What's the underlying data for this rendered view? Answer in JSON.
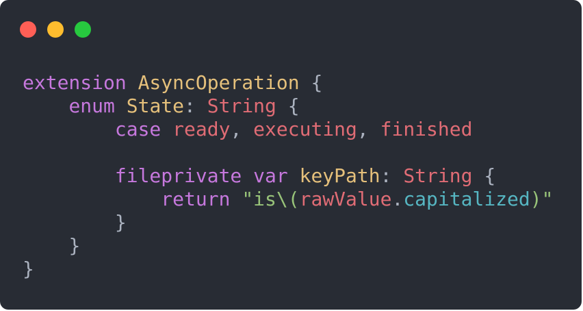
{
  "window": {
    "controls": [
      "close-button",
      "minimize-button",
      "zoom-button"
    ]
  },
  "colors": {
    "background": "#282c34",
    "close": "#ff5f56",
    "minimize": "#ffbd2e",
    "zoom": "#27c93f",
    "keyword": "#c678dd",
    "type": "#e5c07b",
    "identifier": "#e06c75",
    "string": "#98c379",
    "method": "#56b6c2",
    "punctuation": "#abb2bf"
  },
  "code": {
    "lines": [
      [
        {
          "t": "extension",
          "c": "keyword"
        },
        {
          "t": " ",
          "c": "punct"
        },
        {
          "t": "AsyncOperation",
          "c": "type"
        },
        {
          "t": " {",
          "c": "punct"
        }
      ],
      [
        {
          "t": "    ",
          "c": "punct"
        },
        {
          "t": "enum",
          "c": "keyword"
        },
        {
          "t": " ",
          "c": "punct"
        },
        {
          "t": "State",
          "c": "type"
        },
        {
          "t": ": ",
          "c": "punct"
        },
        {
          "t": "String",
          "c": "red"
        },
        {
          "t": " {",
          "c": "punct"
        }
      ],
      [
        {
          "t": "        ",
          "c": "punct"
        },
        {
          "t": "case",
          "c": "keyword"
        },
        {
          "t": " ",
          "c": "punct"
        },
        {
          "t": "ready",
          "c": "red"
        },
        {
          "t": ", ",
          "c": "punct"
        },
        {
          "t": "executing",
          "c": "red"
        },
        {
          "t": ", ",
          "c": "punct"
        },
        {
          "t": "finished",
          "c": "red"
        }
      ],
      [],
      [
        {
          "t": "        ",
          "c": "punct"
        },
        {
          "t": "fileprivate",
          "c": "keyword"
        },
        {
          "t": " ",
          "c": "punct"
        },
        {
          "t": "var",
          "c": "keyword"
        },
        {
          "t": " ",
          "c": "punct"
        },
        {
          "t": "keyPath",
          "c": "type"
        },
        {
          "t": ": ",
          "c": "punct"
        },
        {
          "t": "String",
          "c": "red"
        },
        {
          "t": " {",
          "c": "punct"
        }
      ],
      [
        {
          "t": "            ",
          "c": "punct"
        },
        {
          "t": "return",
          "c": "keyword"
        },
        {
          "t": " ",
          "c": "punct"
        },
        {
          "t": "\"is\\(",
          "c": "string"
        },
        {
          "t": "rawValue",
          "c": "red"
        },
        {
          "t": ".",
          "c": "punct"
        },
        {
          "t": "capitalized",
          "c": "cyan"
        },
        {
          "t": ")\"",
          "c": "string"
        }
      ],
      [
        {
          "t": "        ",
          "c": "punct"
        },
        {
          "t": "}",
          "c": "punct"
        }
      ],
      [
        {
          "t": "    ",
          "c": "punct"
        },
        {
          "t": "}",
          "c": "punct"
        }
      ],
      [
        {
          "t": "}",
          "c": "punct"
        }
      ]
    ]
  }
}
